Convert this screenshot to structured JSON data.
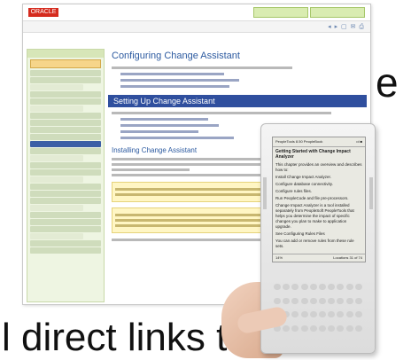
{
  "slide": {
    "partial_word": "e",
    "bottom_text": "l direct links to"
  },
  "doc_window": {
    "brand": "ORACLE",
    "page_title": "Configuring Change Assistant",
    "section_heading": "Setting Up Change Assistant",
    "subsection_heading": "Installing Change Assistant"
  },
  "kindle": {
    "header_left": "PeopleTools 8.50 PeopleBook",
    "header_right": "•ıl ■",
    "title": "Getting Started with Change Impact Analyzer",
    "paragraphs": [
      "This chapter provides an overview and describes how to:",
      "Install Change Impact Analyzer.",
      "Configure database connectivity.",
      "Configure rules files.",
      "Run PeopleCode and file pre-processors.",
      "Change Impact Analyzer is a tool installed separately from PeopleSoft PeopleTools that helps you determine the impact of specific changes you plan to make to application upgrade.",
      "See Configuring Rules Files",
      "You can add or remove rules from these rule sets."
    ],
    "footer_left": "14%",
    "footer_right": "Locations 31 of 74"
  }
}
